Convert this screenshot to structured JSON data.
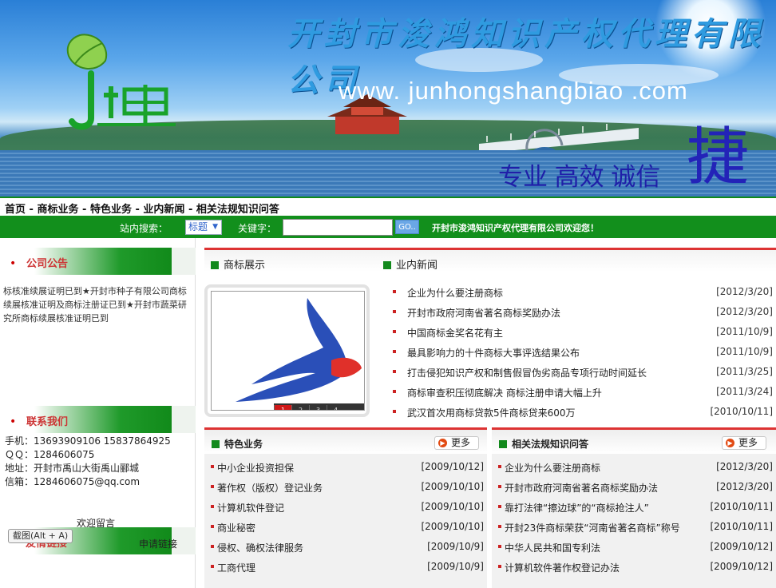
{
  "banner": {
    "company_title": "开封市浚鸿知识产权代理有限公司",
    "url": "www. junhongshangbiao .com",
    "slogan": "专业 高效 诚信",
    "slogan_big": "捷"
  },
  "nav": {
    "items": [
      "首页",
      "商标业务",
      "特色业务",
      "业内新闻",
      "相关法规知识问答"
    ],
    "separator": " - "
  },
  "search": {
    "site_label": "站内搜索：",
    "select_value": "标题",
    "keyword_label": "关键字：",
    "keyword_value": "",
    "go_label": "GO..",
    "welcome": "开封市浚鸿知识产权代理有限公司欢迎您！"
  },
  "sidebar": {
    "notice_title": "公司公告",
    "notice_text": "标核准续展证明已到★开封市种子有限公司商标续展核准证明及商标注册证已到★开封市蔬菜研究所商标续展核准证明已到",
    "contact_title": "联系我们",
    "contact_lines": [
      "手机：13693909106 15837864925",
      "ＱＱ：1284606075",
      "地址：开封市禹山大街禹山郦城",
      "信箱：1284606075@qq.com"
    ],
    "leave_message": "欢迎留言",
    "screenshot_tooltip": "截图(Alt + A)",
    "friend_links_title": "友情链接",
    "apply_link": "申请链接"
  },
  "tabs": {
    "trademark_show": "商标展示",
    "industry_news": "业内新闻"
  },
  "slideshow": {
    "pages": [
      "1",
      "2",
      "3",
      "4"
    ],
    "active": 0
  },
  "news": [
    {
      "title": "企业为什么要注册商标",
      "date": "[2012/3/20]"
    },
    {
      "title": "开封市政府河南省著名商标奖励办法",
      "date": "[2012/3/20]"
    },
    {
      "title": " 中国商标金奖名花有主",
      "date": "[2011/10/9]"
    },
    {
      "title": "最具影响力的十件商标大事评选结果公布",
      "date": "[2011/10/9]"
    },
    {
      "title": "打击侵犯知识产权和制售假冒伪劣商品专项行动时间延长",
      "date": "[2011/3/25]"
    },
    {
      "title": "商标审查积压彻底解决 商标注册申请大幅上升",
      "date": "[2011/3/24]"
    },
    {
      "title": "武汉首次用商标贷款5件商标贷来600万",
      "date": "[2010/10/11]"
    }
  ],
  "featured": {
    "title": "特色业务",
    "more": "更多",
    "items": [
      {
        "title": "中小企业投资担保",
        "date": "[2009/10/12]"
      },
      {
        "title": "著作权（版权）登记业务",
        "date": "[2009/10/10]"
      },
      {
        "title": "计算机软件登记",
        "date": "[2009/10/10]"
      },
      {
        "title": "商业秘密",
        "date": "[2009/10/10]"
      },
      {
        "title": "侵权、确权法律服务",
        "date": "[2009/10/9]"
      },
      {
        "title": "工商代理",
        "date": "[2009/10/9]"
      }
    ]
  },
  "laws": {
    "title": "相关法规知识问答",
    "more": "更多",
    "items": [
      {
        "title": "企业为什么要注册商标",
        "date": "[2012/3/20]"
      },
      {
        "title": "开封市政府河南省著名商标奖励办法",
        "date": "[2012/3/20]"
      },
      {
        "title": "靠打法律“擦边球”的“商标抢注人”",
        "date": "[2010/10/11]"
      },
      {
        "title": "开封23件商标荣获“河南省著名商标”称号",
        "date": "[2010/10/11]"
      },
      {
        "title": "中华人民共和国专利法",
        "date": "[2009/10/12]"
      },
      {
        "title": "计算机软件著作权登记办法",
        "date": "[2009/10/12]"
      }
    ]
  },
  "colors": {
    "accent_green": "#128f1c",
    "accent_red": "#d33333"
  }
}
